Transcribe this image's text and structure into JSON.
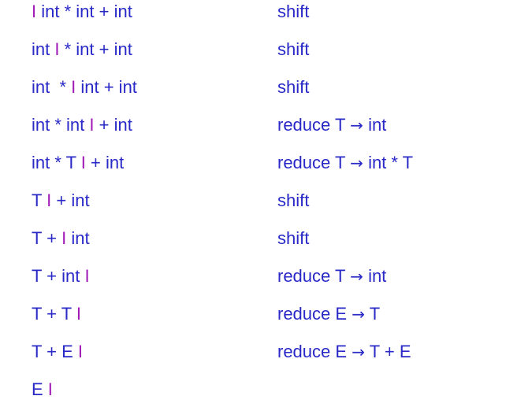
{
  "colors": {
    "text": "#2929c8",
    "marker": "#a01ab6",
    "background": "#ffffff"
  },
  "marker_char": "I",
  "arrow_char": "→",
  "rows": [
    {
      "before": "",
      "after": " int * int + int",
      "action": {
        "verb": "shift"
      }
    },
    {
      "before": "int ",
      "after": " * int + int",
      "action": {
        "verb": "shift"
      }
    },
    {
      "before": "int  * ",
      "after": " int + int",
      "action": {
        "verb": "shift"
      }
    },
    {
      "before": "int * int ",
      "after": " + int",
      "action": {
        "verb": "reduce",
        "lhs": "T",
        "rhs": "int"
      }
    },
    {
      "before": "int * T ",
      "after": " + int",
      "action": {
        "verb": "reduce",
        "lhs": "T",
        "rhs": "int * T"
      }
    },
    {
      "before": "T ",
      "after": " + int",
      "action": {
        "verb": "shift"
      }
    },
    {
      "before": "T + ",
      "after": " int",
      "action": {
        "verb": "shift"
      }
    },
    {
      "before": "T + int ",
      "after": "",
      "action": {
        "verb": "reduce",
        "lhs": "T",
        "rhs": "int"
      }
    },
    {
      "before": "T + T ",
      "after": "",
      "action": {
        "verb": "reduce",
        "lhs": "E",
        "rhs": "T"
      }
    },
    {
      "before": "T + E ",
      "after": "",
      "action": {
        "verb": "reduce",
        "lhs": "E",
        "rhs": "T + E"
      }
    },
    {
      "before": "E ",
      "after": "",
      "action": null
    }
  ]
}
